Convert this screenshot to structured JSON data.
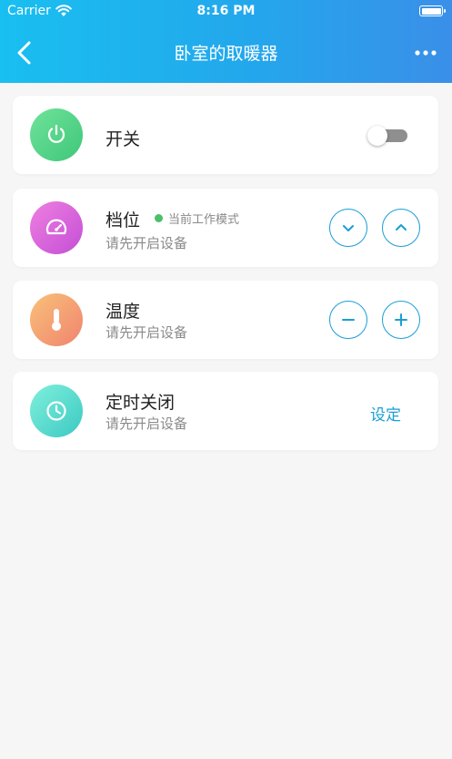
{
  "status_bar": {
    "carrier": "Carrier",
    "time": "8:16 PM"
  },
  "nav": {
    "title": "卧室的取暖器"
  },
  "colors": {
    "accent": "#1a9ed6",
    "header_start": "#19bff0",
    "header_end": "#3a8fe8",
    "mode_dot": "#4bbf6b"
  },
  "cards": {
    "power": {
      "title": "开关",
      "icon": "power-icon",
      "toggle_on": false
    },
    "gear": {
      "title": "档位",
      "mode_tag": "当前工作模式",
      "subtitle": "请先开启设备",
      "icon": "gauge-icon"
    },
    "temperature": {
      "title": "温度",
      "subtitle": "请先开启设备",
      "icon": "thermometer-icon"
    },
    "timer": {
      "title": "定时关闭",
      "subtitle": "请先开启设备",
      "action_label": "设定",
      "icon": "clock-icon"
    }
  }
}
